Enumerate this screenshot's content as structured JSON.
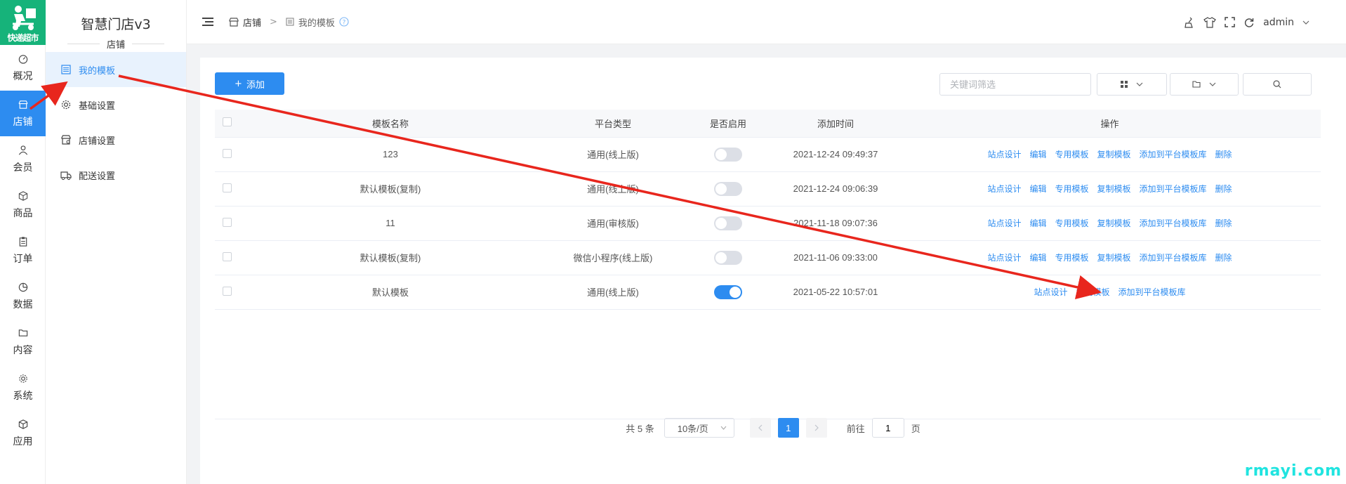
{
  "brand": {
    "logo_text": "快递超市",
    "color": "#16b37a"
  },
  "rail": [
    {
      "label": "概况",
      "icon": "dashboard-icon"
    },
    {
      "label": "店铺",
      "icon": "store-icon",
      "active": true
    },
    {
      "label": "会员",
      "icon": "user-icon"
    },
    {
      "label": "商品",
      "icon": "box-icon"
    },
    {
      "label": "订单",
      "icon": "clipboard-icon"
    },
    {
      "label": "数据",
      "icon": "chart-icon"
    },
    {
      "label": "内容",
      "icon": "folder-icon"
    },
    {
      "label": "系统",
      "icon": "gear-icon"
    },
    {
      "label": "应用",
      "icon": "cube-icon"
    }
  ],
  "subnav": {
    "app_title": "智慧门店v3",
    "section": "店铺",
    "items": [
      {
        "label": "我的模板",
        "icon": "template-icon",
        "active": true
      },
      {
        "label": "基础设置",
        "icon": "gear-icon"
      },
      {
        "label": "店铺设置",
        "icon": "store-settings-icon"
      },
      {
        "label": "配送设置",
        "icon": "truck-icon"
      }
    ]
  },
  "header": {
    "breadcrumb": {
      "root": "店铺",
      "sep": ">",
      "current": "我的模板"
    },
    "user": "admin"
  },
  "toolbar": {
    "add_label": "添加",
    "keyword_placeholder": "关键词筛选"
  },
  "table": {
    "columns": [
      "模板名称",
      "平台类型",
      "是否启用",
      "添加时间",
      "操作"
    ],
    "rows": [
      {
        "name": "123",
        "platform": "通用(线上版)",
        "enabled": false,
        "time": "2021-12-24 09:49:37",
        "ops": [
          "站点设计",
          "编辑",
          "专用模板",
          "复制模板",
          "添加到平台模板库",
          "删除"
        ]
      },
      {
        "name": "默认模板(复制)",
        "platform": "通用(线上版)",
        "enabled": false,
        "time": "2021-12-24 09:06:39",
        "ops": [
          "站点设计",
          "编辑",
          "专用模板",
          "复制模板",
          "添加到平台模板库",
          "删除"
        ]
      },
      {
        "name": "11",
        "platform": "通用(审核版)",
        "enabled": false,
        "time": "2021-11-18 09:07:36",
        "ops": [
          "站点设计",
          "编辑",
          "专用模板",
          "复制模板",
          "添加到平台模板库",
          "删除"
        ]
      },
      {
        "name": "默认模板(复制)",
        "platform": "微信小程序(线上版)",
        "enabled": false,
        "time": "2021-11-06 09:33:00",
        "ops": [
          "站点设计",
          "编辑",
          "专用模板",
          "复制模板",
          "添加到平台模板库",
          "删除"
        ]
      },
      {
        "name": "默认模板",
        "platform": "通用(线上版)",
        "enabled": true,
        "time": "2021-05-22 10:57:01",
        "ops": [
          "站点设计",
          "复制模板",
          "添加到平台模板库"
        ]
      }
    ]
  },
  "pagination": {
    "total": "共 5 条",
    "page_size": "10条/页",
    "current": "1",
    "goto_prefix": "前往",
    "goto_value": "1",
    "goto_suffix": "页"
  },
  "watermark": "rmayi.com",
  "colors": {
    "primary": "#2d8cf0",
    "annotation_arrow": "#e8261d"
  }
}
